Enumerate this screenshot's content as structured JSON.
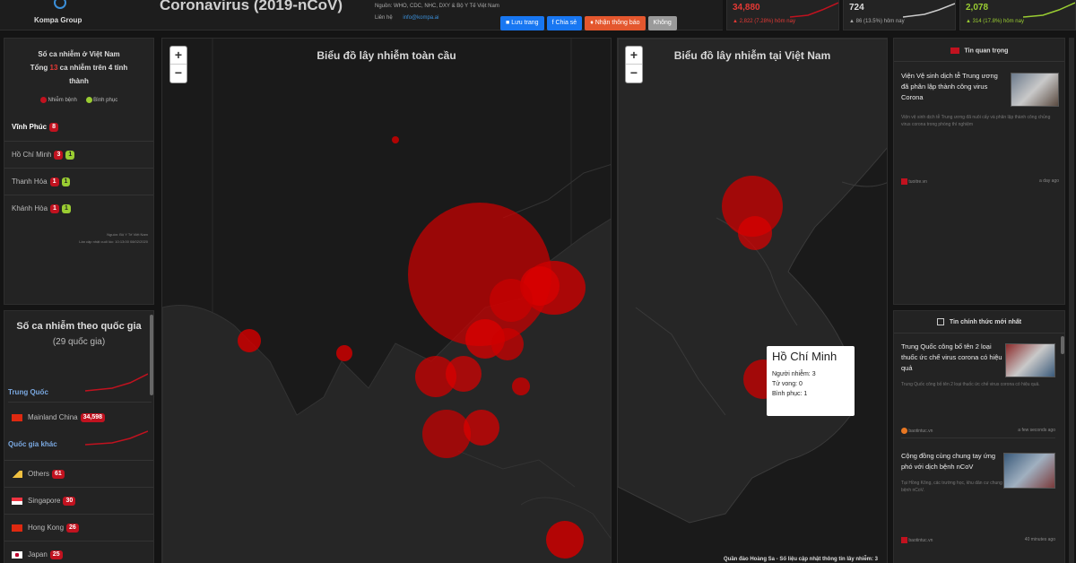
{
  "header": {
    "logo_text": "Kompa Group",
    "title": "Coronavirus (2019-nCoV)",
    "source_line": "Nguồn: WHO, CDC, NHC, DXY & Bộ Y Tế Việt Nam",
    "contact_label": "Liên hệ",
    "contact_link": "info@kompa.ai",
    "buttons": [
      {
        "label": "Lưu trang",
        "color": "#1877f2"
      },
      {
        "label": "Chia sẻ",
        "color": "#1877f2"
      },
      {
        "label": "Nhận thông báo",
        "color": "#e4572e"
      },
      {
        "label": "Không",
        "color": "#9a9a9a"
      }
    ]
  },
  "stats": [
    {
      "value": "34,880",
      "sub": "▲ 2,822 (7.28%) hôm nay",
      "color": "#e53935"
    },
    {
      "value": "724",
      "sub": "▲ 86 (13.5%) hôm nay",
      "color": "#dddddd"
    },
    {
      "value": "2,078",
      "sub": "▲ 314 (17.8%) hôm nay",
      "color": "#9acd32"
    }
  ],
  "vn_panel": {
    "title_line1": "Số ca nhiễm ở Việt Nam",
    "title_line2_prefix": "Tổng",
    "total": "13",
    "title_line2_suffix": "ca nhiễm trên 4 tỉnh",
    "title_line3": "thành",
    "legend_infected": "Nhiễm bệnh",
    "legend_recovered": "Bình phục",
    "provinces": [
      {
        "name": "Vĩnh Phúc",
        "infected": "8",
        "recovered": ""
      },
      {
        "name": "Hồ Chí Minh",
        "infected": "3",
        "recovered": "1"
      },
      {
        "name": "Thanh Hóa",
        "infected": "1",
        "recovered": "1"
      },
      {
        "name": "Khánh Hòa",
        "infected": "1",
        "recovered": "1"
      }
    ],
    "footer1": "Nguồn: Bộ Y Tế Việt Nam",
    "footer2": "Lần cập nhật cuối lúc: 10:13:00 08/02/2020"
  },
  "country_panel": {
    "title": "Số ca nhiễm theo quốc gia",
    "count": "(29 quốc gia)",
    "group1": "Trung Quốc",
    "china_rows": [
      {
        "name": "Mainland China",
        "value": "34,598"
      }
    ],
    "group2": "Quốc gia khác",
    "rows": [
      {
        "name": "Others",
        "value": "61"
      },
      {
        "name": "Singapore",
        "value": "30"
      },
      {
        "name": "Hong Kong",
        "value": "26"
      },
      {
        "name": "Japan",
        "value": "25"
      }
    ]
  },
  "map_global": {
    "title": "Biểu đồ lây nhiễm toàn cầu"
  },
  "map_vn": {
    "title": "Biểu đồ lây nhiễm tại Việt Nam",
    "attribution": "Quần đảo Hoàng Sa - Số liệu cập nhật thông tin lây nhiễm: 3",
    "popup": {
      "title": "Hồ Chí Minh",
      "infected_label": "Người nhiễm:",
      "infected": "3",
      "death_label": "Tử vong:",
      "death": "0",
      "recovered_label": "Bình phục:",
      "recovered": "1"
    }
  },
  "news_important": {
    "header": "Tin quan trọng",
    "item": {
      "title": "Viện Vệ sinh dịch tễ Trung ương đã phân lập thành công virus Corona",
      "excerpt": "Viện vệ sinh dịch tễ Trung ương đã nuôi cấy và phân lập thành công chủng virus corona trong phòng thí nghiệm",
      "source": "tuoitre.vn",
      "time": "a day ago"
    }
  },
  "news_latest": {
    "header": "Tin chính thức mới nhất",
    "items": [
      {
        "title": "Trung Quốc công bố tên 2 loại thuốc ức chế virus corona có hiệu quả",
        "excerpt": "Trung Quốc công bố tên 2 loại thuốc ức chế virus corona có hiệu quả.",
        "source": "baotintuc.vn",
        "time": "a few seconds ago"
      },
      {
        "title": "Cộng đồng cùng chung tay ứng phó với dịch bệnh nCoV",
        "excerpt": "Tại Hồng Kông, các trường học, khu dân cư chung tay phòng chống dịch bệnh nCoV.",
        "source": "baotintuc.vn",
        "time": "40 minutes ago"
      }
    ]
  }
}
